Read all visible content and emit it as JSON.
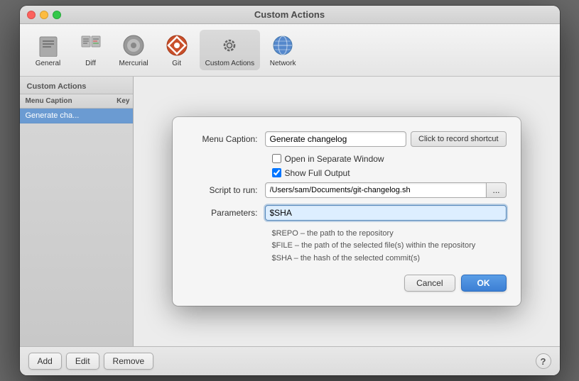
{
  "window": {
    "title": "Custom Actions"
  },
  "toolbar": {
    "items": [
      {
        "id": "general",
        "label": "General",
        "icon": "general"
      },
      {
        "id": "diff",
        "label": "Diff",
        "icon": "diff"
      },
      {
        "id": "mercurial",
        "label": "Mercurial",
        "icon": "mercurial"
      },
      {
        "id": "git",
        "label": "Git",
        "icon": "git"
      },
      {
        "id": "custom-actions",
        "label": "Custom Actions",
        "icon": "custom-actions",
        "active": true
      },
      {
        "id": "network",
        "label": "Network",
        "icon": "network"
      }
    ]
  },
  "sidebar": {
    "header": "Custom Actions",
    "columns": {
      "caption": "Menu Caption",
      "key": "Key"
    },
    "rows": [
      {
        "caption": "Generate cha...",
        "key": "",
        "selected": true
      }
    ]
  },
  "modal": {
    "menu_caption_label": "Menu Caption:",
    "menu_caption_value": "Generate changelog",
    "shortcut_label": "Click to record shortcut",
    "open_separate_window_label": "Open in Separate Window",
    "open_separate_window_checked": false,
    "show_full_output_label": "Show Full Output",
    "show_full_output_checked": true,
    "script_label": "Script to run:",
    "script_value": "/Users/sam/Documents/git-changelog.sh",
    "browse_label": "...",
    "parameters_label": "Parameters:",
    "parameters_value": "$SHA",
    "help_lines": [
      "$REPO – the path to the repository",
      "$FILE – the path of the selected file(s) within the repository",
      "$SHA – the hash of the selected commit(s)"
    ],
    "cancel_label": "Cancel",
    "ok_label": "OK"
  },
  "footer": {
    "add_label": "Add",
    "edit_label": "Edit",
    "remove_label": "Remove",
    "help_label": "?"
  }
}
